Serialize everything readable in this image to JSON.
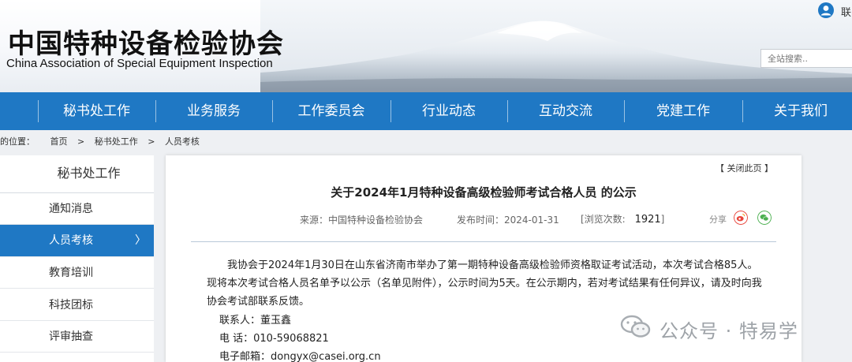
{
  "header": {
    "site_name_cn": "中国特种设备检验协会",
    "site_name_en": "China Association of Special Equipment Inspection",
    "user_link": "联",
    "search_placeholder": "全站搜索.."
  },
  "nav": {
    "items": [
      "秘书处工作",
      "业务服务",
      "工作委员会",
      "行业动态",
      "互动交流",
      "党建工作",
      "关于我们"
    ]
  },
  "breadcrumb": {
    "prefix": "的位置：",
    "items": [
      "首页",
      "秘书处工作",
      "人员考核"
    ],
    "separator": ">"
  },
  "sidebar": {
    "title": "秘书处工作",
    "items": [
      {
        "label": "通知消息",
        "active": false
      },
      {
        "label": "人员考核",
        "active": true
      },
      {
        "label": "教育培训",
        "active": false
      },
      {
        "label": "科技团标",
        "active": false
      },
      {
        "label": "评审抽查",
        "active": false
      }
    ],
    "active_chevron": "〉"
  },
  "article": {
    "close_label": "【 关闭此页 】",
    "title": "关于2024年1月特种设备高级检验师考试合格人员 的公示",
    "source": "来源：中国特种设备检验协会",
    "published": "发布时间：2024-01-31",
    "views_label": "[浏览次数:",
    "views_value": "1921",
    "views_suffix": "]",
    "share_label": "分享",
    "body": "我协会于2024年1月30日在山东省济南市举办了第一期特种设备高级检验师资格取证考试活动，本次考试合格85人。现将本次考试合格人员名单予以公示（名单见附件），公示时间为5天。在公示期内，若对考试结果有任何异议，请及时向我协会考试部联系反馈。",
    "contact": "联系人：董玉鑫",
    "phone": "电  话：010-59068821",
    "email": "电子邮箱：dongyx@casei.org.cn"
  },
  "watermark": {
    "text": "公众号 · 特易学"
  },
  "colors": {
    "nav_bg": "#1f78c4",
    "active_sidebar_bg": "#1f78c4",
    "page_bg": "#eef0f3"
  },
  "icons": {
    "user": "user-icon",
    "share_weibo": "weibo-icon",
    "share_wechat": "wechat-icon",
    "watermark": "wechat-logo-icon"
  }
}
